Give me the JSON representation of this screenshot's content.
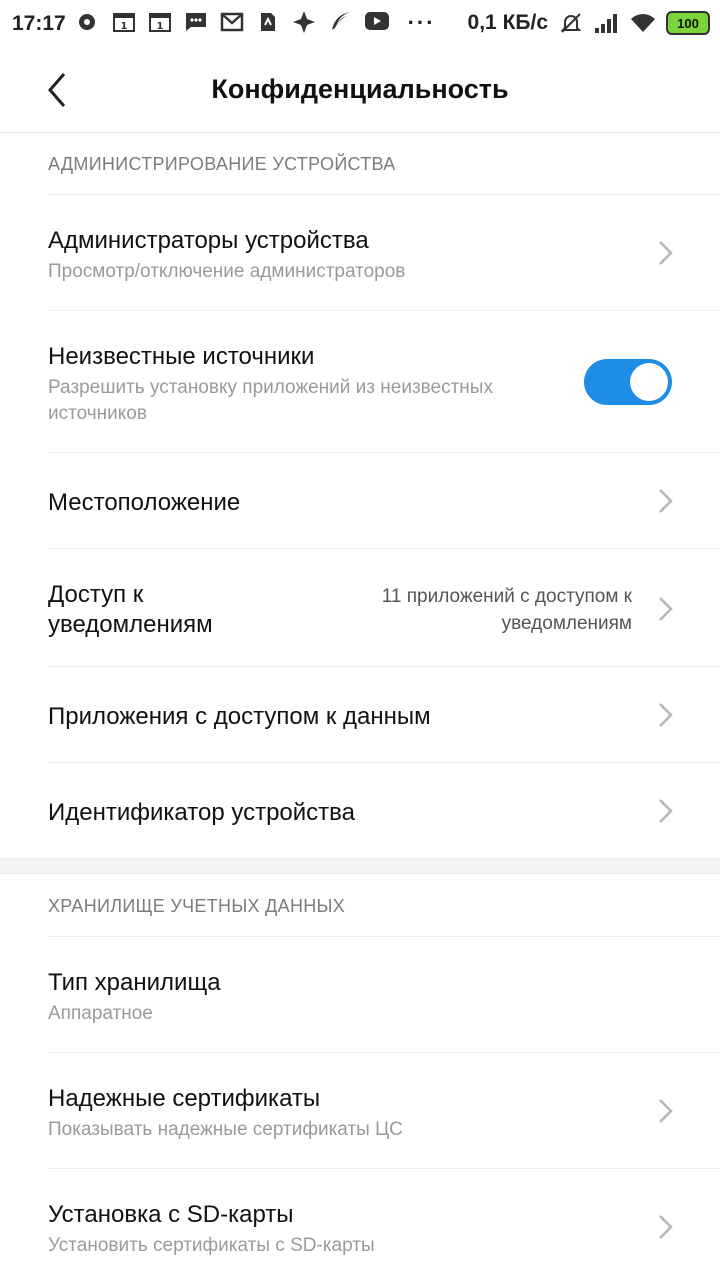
{
  "status_bar": {
    "time": "17:17",
    "network_speed": "0,1 КБ/с",
    "battery": "100",
    "more": "···"
  },
  "header": {
    "title": "Конфиденциальность"
  },
  "sections": {
    "device_admin": {
      "header": "АДМИНИСТРИРОВАНИЕ УСТРОЙСТВА",
      "admins_title": "Администраторы устройства",
      "admins_sub": "Просмотр/отключение администраторов",
      "unknown_title": "Неизвестные источники",
      "unknown_sub1": "Разрешить установку приложений из неизвестных",
      "unknown_sub2": "источников",
      "unknown_enabled": true,
      "location_title": "Местоположение",
      "notif_title1": "Доступ к",
      "notif_title2": "уведомлениям",
      "notif_value1": "11 приложений с доступом к",
      "notif_value2": "уведомлениям",
      "data_access_title": "Приложения с доступом к данным",
      "device_id_title": "Идентификатор устройства"
    },
    "credentials": {
      "header": "ХРАНИЛИЩЕ УЧЕТНЫХ ДАННЫХ",
      "storage_type_title": "Тип хранилища",
      "storage_type_sub": "Аппаратное",
      "trusted_title": "Надежные сертификаты",
      "trusted_sub": "Показывать надежные сертификаты ЦС",
      "sd_title": "Установка с SD-карты",
      "sd_sub": "Установить сертификаты с SD-карты"
    }
  },
  "colors": {
    "accent": "#1f8ce6"
  }
}
